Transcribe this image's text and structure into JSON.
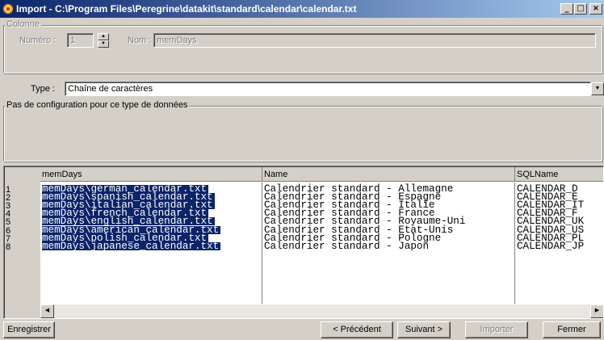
{
  "window": {
    "title": "Import - C:\\Program Files\\Peregrine\\datakit\\standard\\calendar\\calendar.txt",
    "controls": [
      "_",
      "□",
      "×"
    ]
  },
  "colonne": {
    "legend": "Colonne",
    "numero_label": "Numéro :",
    "numero_value": "1",
    "nom_label": "Nom :",
    "nom_value": "memDays"
  },
  "type": {
    "label": "Type :",
    "value": "Chaîne de caractères"
  },
  "config": {
    "message": "Pas de configuration pour ce type de données"
  },
  "grid": {
    "headers": [
      "memDays",
      "Name",
      "SQLName"
    ],
    "rows": [
      {
        "num": "1",
        "memdays": "memDays\\german_calendar.txt",
        "name": "Calendrier standard - Allemagne",
        "sql": "CALENDAR_D"
      },
      {
        "num": "2",
        "memdays": "memDays\\spanish_calendar.txt",
        "name": "Calendrier standard - Espagne",
        "sql": "CALENDAR_E"
      },
      {
        "num": "3",
        "memdays": "memDays\\italian_calendar.txt",
        "name": "Calendrier standard - Italie",
        "sql": "CALENDAR_IT"
      },
      {
        "num": "4",
        "memdays": "memDays\\french_calendar.txt",
        "name": "Calendrier standard - France",
        "sql": "CALENDAR_F"
      },
      {
        "num": "5",
        "memdays": "memDays\\english_calendar.txt",
        "name": "Calendrier standard - Royaume-Uni",
        "sql": "CALENDAR_UK"
      },
      {
        "num": "6",
        "memdays": "memDays\\american_calendar.txt",
        "name": "Calendrier standard - Etat-Unis",
        "sql": "CALENDAR_US"
      },
      {
        "num": "7",
        "memdays": "memDays\\polish_calendar.txt",
        "name": "Calendrier standard - Pologne",
        "sql": "CALENDAR_PL"
      },
      {
        "num": "8",
        "memdays": "memDays\\japanese_calendar.txt",
        "name": "Calendrier standard - Japon",
        "sql": "CALENDAR_JP"
      }
    ]
  },
  "buttons": {
    "enregistrer": "Enregistrer",
    "precedent": "< Précédent",
    "suivant": "Suivant >",
    "importer": "Importer",
    "fermer": "Fermer"
  },
  "colors": {
    "selection": "#0a246a",
    "face": "#d4d0c8"
  }
}
